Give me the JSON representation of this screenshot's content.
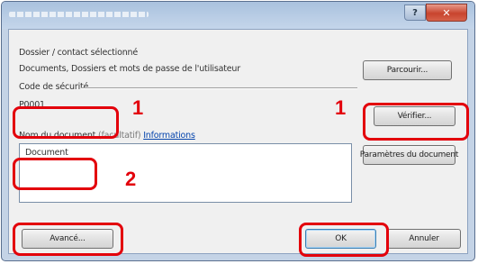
{
  "window": {
    "title": "",
    "close_glyph": "✕",
    "help_glyph": "?"
  },
  "form": {
    "selected_label": "Dossier / contact sélectionné",
    "selected_value": "Documents, Dossiers et mots de passe de l'utilisateur",
    "browse_button": "Parcourir...",
    "code_label": "Code de sécurité",
    "code_value": "P0001",
    "verify_button": "Vérifier...",
    "doc_label_prefix": "Nom du document",
    "doc_label_ghost": "(facultatif)",
    "doc_label_link": "Informations",
    "doc_value": "Document",
    "doc_settings_button": "Paramètres du document",
    "advanced_button": "Avancé...",
    "ok_button": "OK",
    "cancel_button": "Annuler"
  },
  "annotations": {
    "step1_left": "1",
    "step1_right": "1",
    "step2": "2"
  },
  "colors": {
    "highlight": "#e3000b",
    "window_frame": "#c4d3e6",
    "client_bg": "#f0f0f0"
  }
}
